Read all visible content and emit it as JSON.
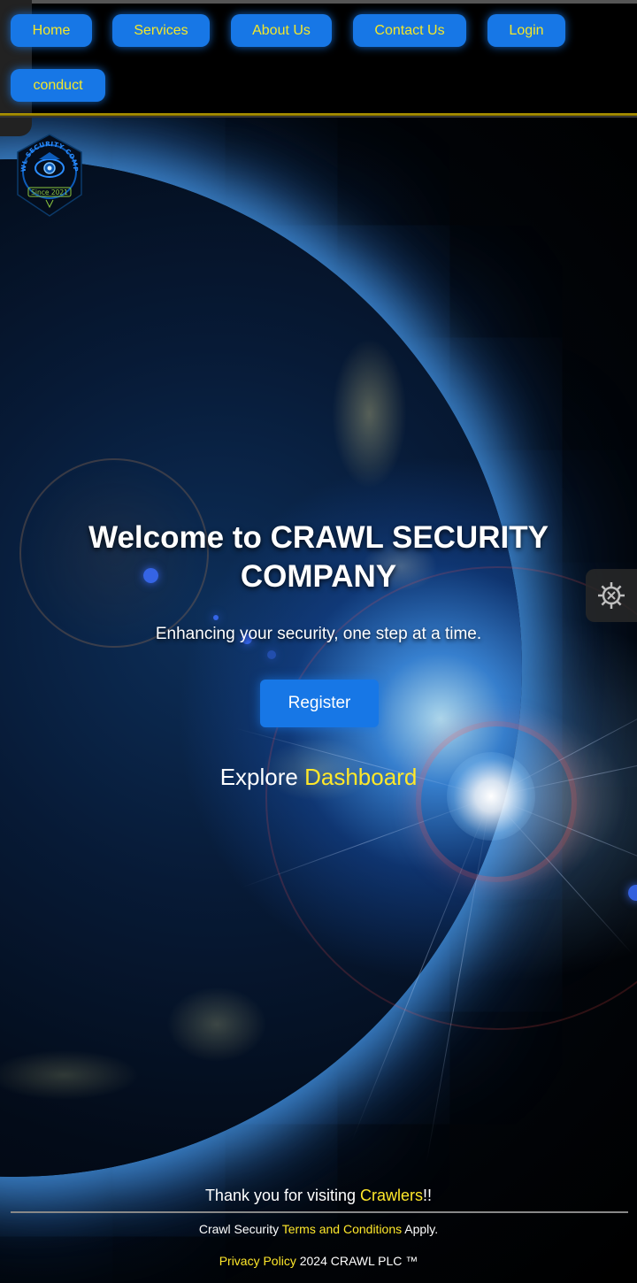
{
  "nav": {
    "items": [
      {
        "label": "Home"
      },
      {
        "label": "Services"
      },
      {
        "label": "About Us"
      },
      {
        "label": "Contact Us"
      },
      {
        "label": "Login"
      },
      {
        "label": "conduct"
      }
    ]
  },
  "logo": {
    "ring_text": "CRAWL SECURITY COMPANY",
    "since_text": "Since 2021"
  },
  "hero": {
    "title_line1": "Welcome to CRAWL SECURITY",
    "title_line2": "COMPANY",
    "subtitle": "Enhancing your security, one step at a time.",
    "register_label": "Register",
    "explore_prefix": "Explore ",
    "explore_link": "Dashboard"
  },
  "settings": {
    "icon": "gear-icon"
  },
  "footer": {
    "thanks_prefix": "Thank you for visiting ",
    "thanks_link": "Crawlers",
    "thanks_suffix": "!!",
    "terms_prefix": "Crawl Security ",
    "terms_link": "Terms and Conditions",
    "terms_suffix": " Apply.",
    "privacy_link": "Privacy Policy",
    "copyright": " 2024 CRAWL PLC ™"
  },
  "colors": {
    "accent": "#1777e6",
    "link": "#ffe82a",
    "background": "#000000"
  }
}
